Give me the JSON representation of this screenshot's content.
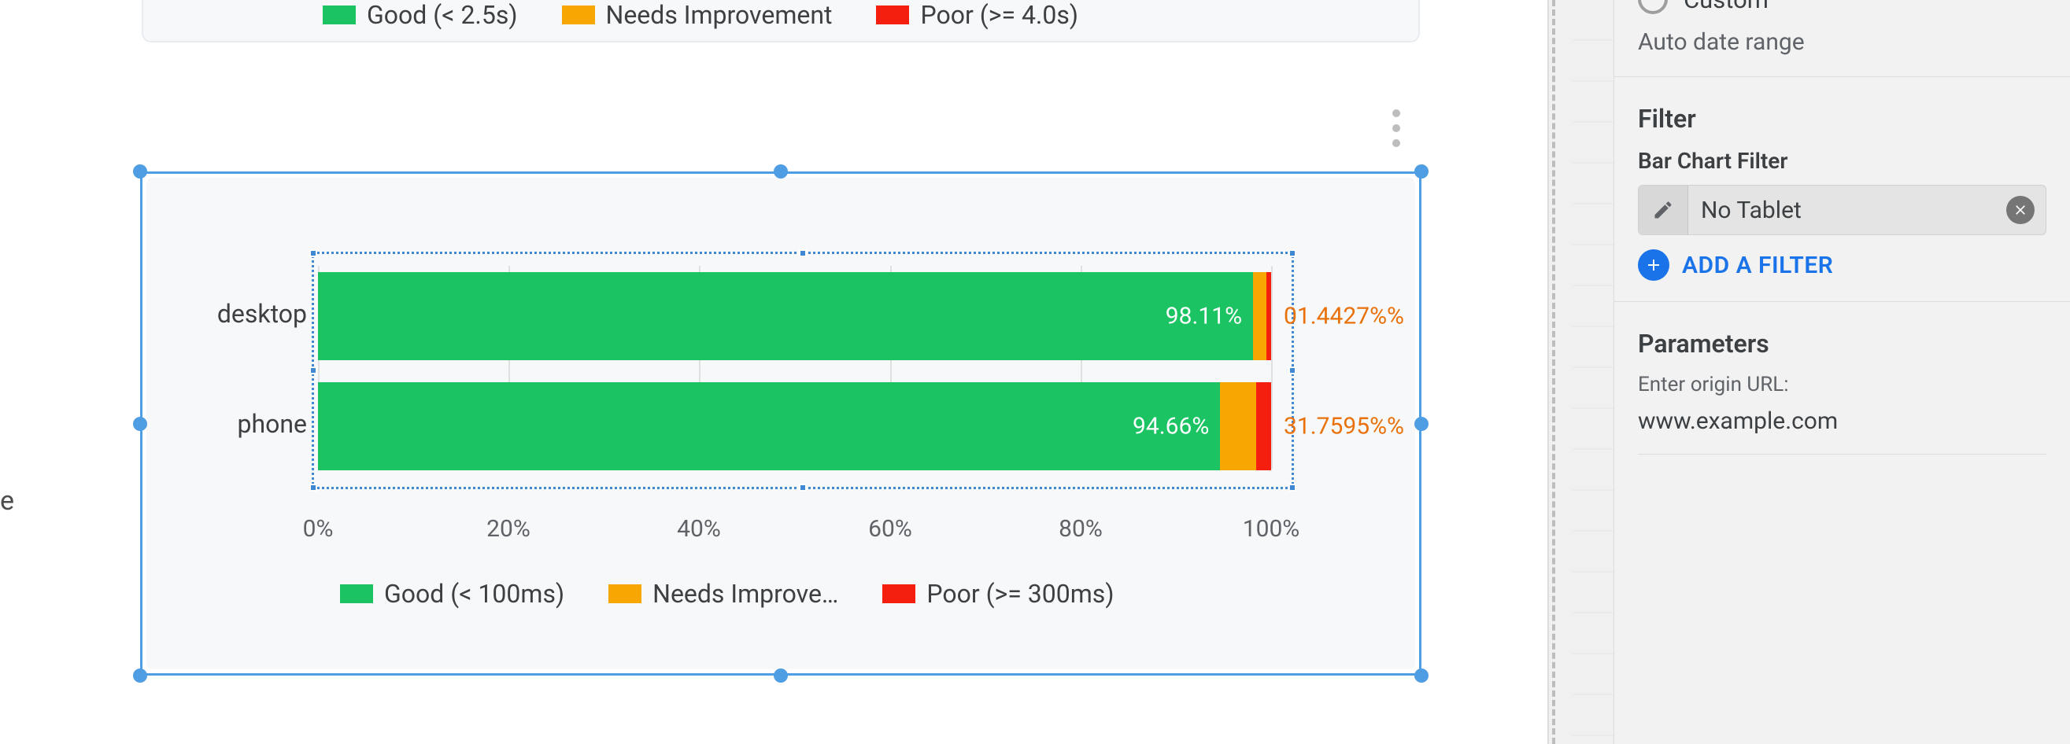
{
  "left_fragment": "e",
  "upper_legend": {
    "items": [
      {
        "color": "#1bc363",
        "label": "Good (< 2.5s)"
      },
      {
        "color": "#f8a602",
        "label": "Needs Improvement"
      },
      {
        "color": "#f51f10",
        "label": "Poor (>= 4.0s)"
      }
    ]
  },
  "lower_legend": {
    "items": [
      {
        "color": "#1bc363",
        "label": "Good (< 100ms)"
      },
      {
        "color": "#f8a602",
        "label": "Needs Improve…"
      },
      {
        "color": "#f51f10",
        "label": "Poor (>= 300ms)"
      }
    ]
  },
  "axis_ticks": [
    "0%",
    "20%",
    "40%",
    "60%",
    "80%",
    "100%"
  ],
  "categories": {
    "r0": "desktop",
    "r1": "phone"
  },
  "bar_labels": {
    "r0_good": "98.11%",
    "r0_overflow": "01.4427%%",
    "r1_good": "94.66%",
    "r1_overflow": "31.7595%%"
  },
  "panel": {
    "custom_label": "Custom",
    "auto_range": "Auto date range",
    "filter_title": "Filter",
    "filter_sub": "Bar Chart Filter",
    "chip_label": "No Tablet",
    "add_filter": "ADD A FILTER",
    "params_title": "Parameters",
    "params_hint": "Enter origin URL:",
    "params_value": "www.example.com"
  },
  "colors": {
    "good": "#1bc363",
    "ni": "#f8a602",
    "poor": "#f51f10",
    "selection": "#4f9ee3",
    "link": "#1a73e8"
  },
  "chart_data": {
    "type": "bar",
    "orientation": "horizontal-stacked",
    "categories": [
      "desktop",
      "phone"
    ],
    "series": [
      {
        "name": "Good (< 100ms)",
        "values": [
          98.11,
          94.66
        ]
      },
      {
        "name": "Needs Improvement",
        "values": [
          1.42,
          3.79
        ]
      },
      {
        "name": "Poor (>= 300ms)",
        "values": [
          0.47,
          1.55
        ]
      }
    ],
    "xlabel": "",
    "ylabel": "",
    "xlim": [
      0,
      100
    ],
    "x_ticks": [
      0,
      20,
      40,
      60,
      80,
      100
    ],
    "title": ""
  }
}
